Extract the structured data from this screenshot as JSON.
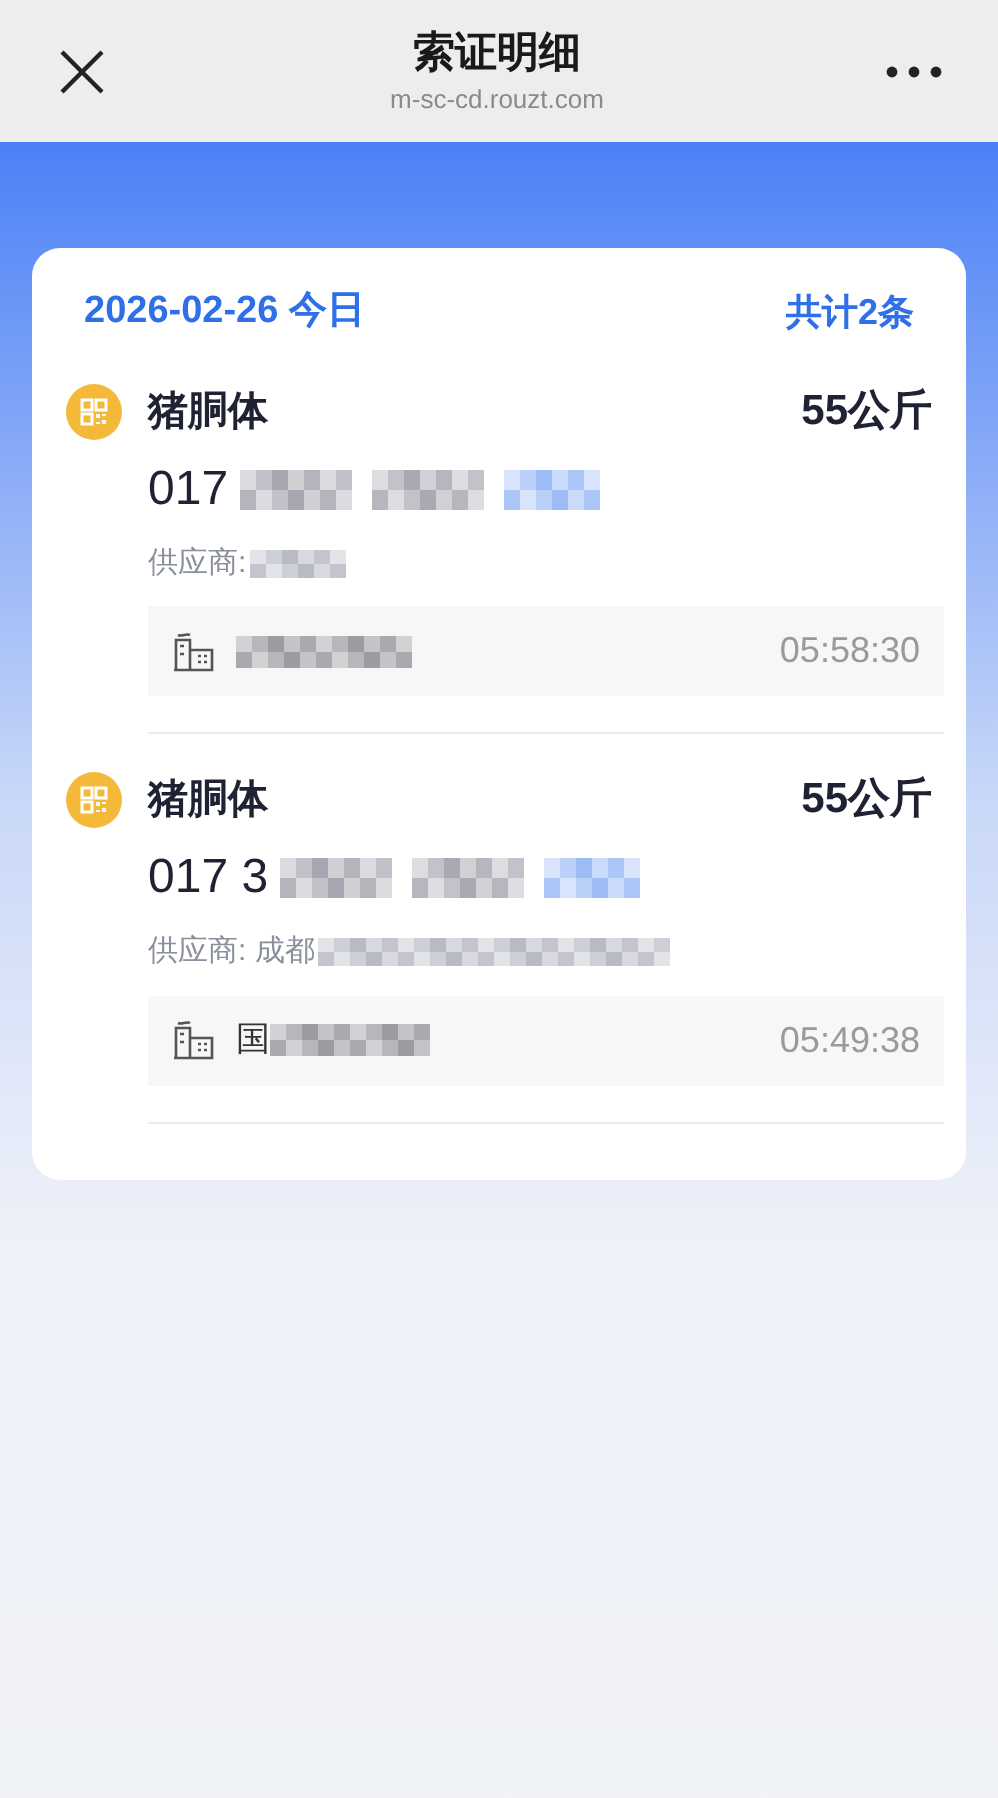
{
  "nav_bar": {
    "title": "索证明细",
    "url": "m-sc-cd.rouzt.com"
  },
  "card": {
    "date": "2026-02-26 今日",
    "total": "共计2条",
    "records": [
      {
        "name": "猪胴体",
        "weight": "55公斤",
        "code": "017",
        "supplier": "供应商:",
        "time": "05:58:30"
      },
      {
        "name": "猪胴体",
        "weight": "55公斤",
        "code": "017 3",
        "supplier": "供应商: 成都",
        "market": "国",
        "time": "05:49:38"
      }
    ]
  }
}
